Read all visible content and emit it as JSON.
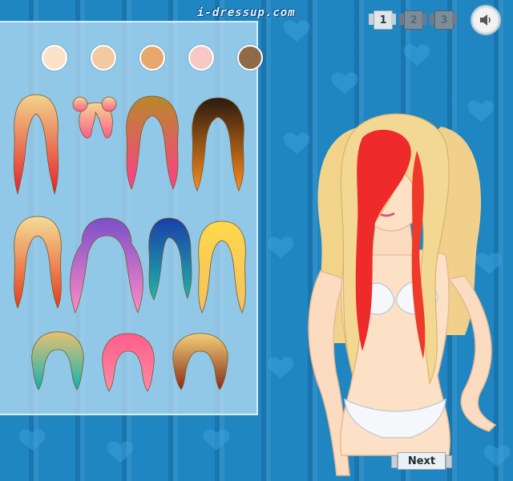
{
  "site": {
    "logo": "i-dressup.com"
  },
  "pages": [
    {
      "label": "1",
      "active": true
    },
    {
      "label": "2",
      "active": false
    },
    {
      "label": "3",
      "active": false
    }
  ],
  "sound": {
    "icon": "speaker-icon"
  },
  "skin_tones": [
    "#fbe2c8",
    "#f2c9a0",
    "#e8a86b",
    "#f9c7c4",
    "#8f6a48"
  ],
  "hairstyles": [
    {
      "name": "blonde-red-long-wig",
      "colors": [
        "#f0d48a",
        "#e8202a"
      ]
    },
    {
      "name": "pink-bow-updo-wig",
      "colors": [
        "#f3d892",
        "#ff5b8c"
      ]
    },
    {
      "name": "ombre-pink-wig",
      "colors": [
        "#b8892a",
        "#ff3d8b"
      ]
    },
    {
      "name": "sunset-ombre-wig",
      "colors": [
        "#2b1a10",
        "#ff8c1a"
      ]
    },
    {
      "name": "blonde-rainbow-tips-wig",
      "colors": [
        "#f4dd97",
        "#e83a1a"
      ]
    },
    {
      "name": "purple-pigtails-wig",
      "colors": [
        "#7a50c8",
        "#ff8ac8"
      ]
    },
    {
      "name": "blue-teal-side-wig",
      "colors": [
        "#1b3fa8",
        "#1fb5a8"
      ]
    },
    {
      "name": "golden-bang-wig",
      "colors": [
        "#ffd84a",
        "#f3c060"
      ]
    },
    {
      "name": "teal-ombre-bob-wig",
      "colors": [
        "#e8c070",
        "#0fb3b5"
      ]
    },
    {
      "name": "pink-bob-wig",
      "colors": [
        "#ff5e8a",
        "#ff8aa5"
      ]
    },
    {
      "name": "braided-blonde-wig",
      "colors": [
        "#f0cf7a",
        "#8a2a18"
      ]
    }
  ],
  "next_button": {
    "label": "Next"
  }
}
